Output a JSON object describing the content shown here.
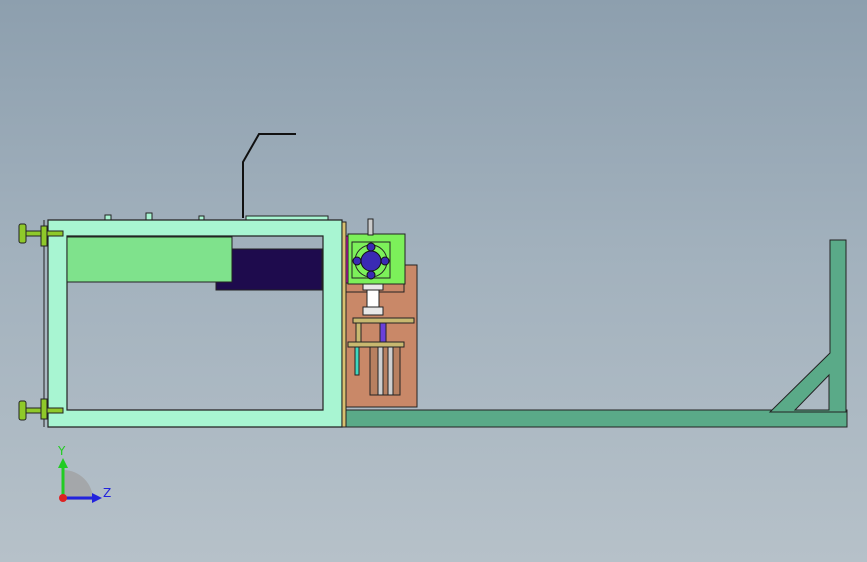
{
  "viewport": {
    "background_top": "#8d9fae",
    "background_bottom": "#b6c1c9"
  },
  "model": {
    "frame_color": "#a8f5d2",
    "plate_color": "#c98868",
    "rail_color": "#5aaa88",
    "motor_color": "#7cf05a",
    "rotor_color": "#3a2ab4",
    "inner_block_color": "#7fe28c",
    "dark_block_color": "#1e0b4d",
    "leveling_foot_color": "#8fc92a"
  },
  "triad": {
    "y_label": "Y",
    "z_label": "Z",
    "y_color": "#22cc22",
    "z_color": "#2222dd",
    "origin_color": "#dd2222"
  }
}
